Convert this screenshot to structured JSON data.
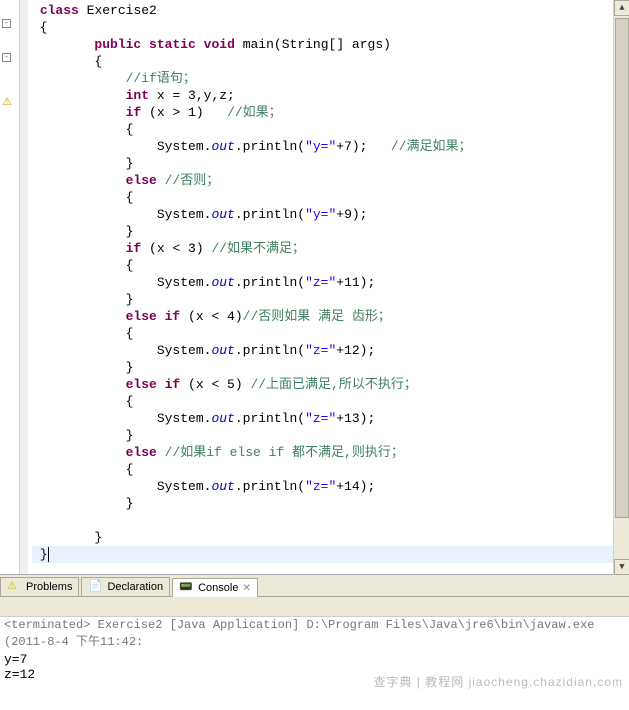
{
  "code": {
    "class_kw": "class",
    "class_name": "Exercise2",
    "public": "public",
    "static": "static",
    "void": "void",
    "main": "main",
    "main_params": "(String[] args)",
    "cmt_if": "//if语句；",
    "int": "int",
    "decl": " x = 3,y,z;",
    "if": "if",
    "cond1": " (x > 1)   ",
    "cmt_ruguo": "//如果；",
    "sys": "System.",
    "out": "out",
    "println": ".println(",
    "str_y": "\"y=\"",
    "plus7": "+7);   ",
    "cmt_manzu": "//满足如果；",
    "else": "else",
    "cmt_fouze": " //否则；",
    "plus9": "+9);",
    "cond3": " (x < 3) ",
    "cmt_bumanzu": "//如果不满足；",
    "str_z": "\"z=\"",
    "plus11": "+11);",
    "elseif": "else if",
    "cond4": " (x < 4)",
    "cmt_chixing": "//否则如果 满足 齿形；",
    "plus12": "+12);",
    "cond5": " (x < 5) ",
    "cmt_yijing": "//上面已满足,所以不执行；",
    "plus13": "+13);",
    "cmt_zhixing": " //如果if else if 都不满足,则执行；",
    "plus14": "+14);"
  },
  "tabs": {
    "problems": "Problems",
    "declaration": "Declaration",
    "console": "Console"
  },
  "terminated": "<terminated> Exercise2 [Java Application] D:\\Program Files\\Java\\jre6\\bin\\javaw.exe (2011-8-4 下午11:42:",
  "output": {
    "line1": "y=7",
    "line2": "z=12"
  },
  "watermark": "查字典 | 教程网\njiaocheng.chazidian.com"
}
